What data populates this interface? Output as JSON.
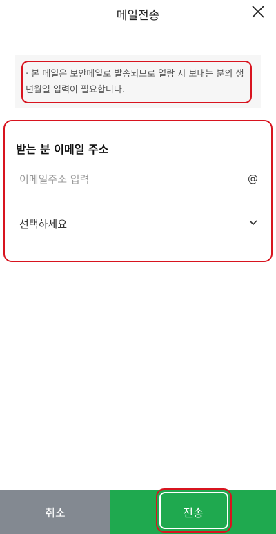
{
  "header": {
    "title": "메일전송"
  },
  "notice": {
    "text": "· 본 메일은 보안메일로 발송되므로 열람 시 보내는 분의 생년월일 입력이 필요합니다."
  },
  "form": {
    "label": "받는 분 이메일 주소",
    "email_placeholder": "이메일주소 입력",
    "email_value": "",
    "at_sign": "@",
    "domain_select": "선택하세요"
  },
  "buttons": {
    "cancel": "취소",
    "send": "전송"
  },
  "colors": {
    "send": "#1fa94f",
    "cancel": "#838991",
    "highlight": "#d8141f"
  }
}
